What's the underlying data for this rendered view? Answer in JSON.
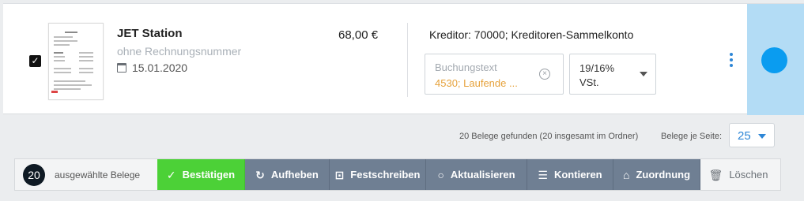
{
  "row": {
    "checked": true,
    "vendor": "JET Station",
    "invoice_number": "ohne Rechnungsnummer",
    "date": "15.01.2020",
    "amount": "68,00 €",
    "kreditor": "Kreditor: 70000; Kreditoren-Sammelkonto",
    "buchungstext_placeholder": "Buchungstext",
    "account": "4530; Laufende ...",
    "tax_line1": "19/16%",
    "tax_line2": "VSt.",
    "status_color": "#0a9cf0"
  },
  "pagination": {
    "found_text": "20 Belege gefunden (20 insgesamt im Ordner)",
    "per_page_label": "Belege je Seite:",
    "per_page_value": "25"
  },
  "actions": {
    "selected_count": "20",
    "selected_label": "ausgewählte Belege",
    "buttons": [
      {
        "label": "Bestätigen",
        "icon": "check-icon",
        "color": "#4cd137"
      },
      {
        "label": "Aufheben",
        "icon": "undo-icon",
        "color": "#6f7f93"
      },
      {
        "label": "Festschreiben",
        "icon": "lock-icon",
        "color": "#6f7f93"
      },
      {
        "label": "Aktualisieren",
        "icon": "bulb-icon",
        "color": "#6f7f93"
      },
      {
        "label": "Kontieren",
        "icon": "list-icon",
        "color": "#6f7f93"
      },
      {
        "label": "Zuordnung",
        "icon": "bank-icon",
        "color": "#6f7f93"
      },
      {
        "label": "Löschen",
        "icon": "trash-icon",
        "color": "#f3f4f5"
      }
    ]
  }
}
